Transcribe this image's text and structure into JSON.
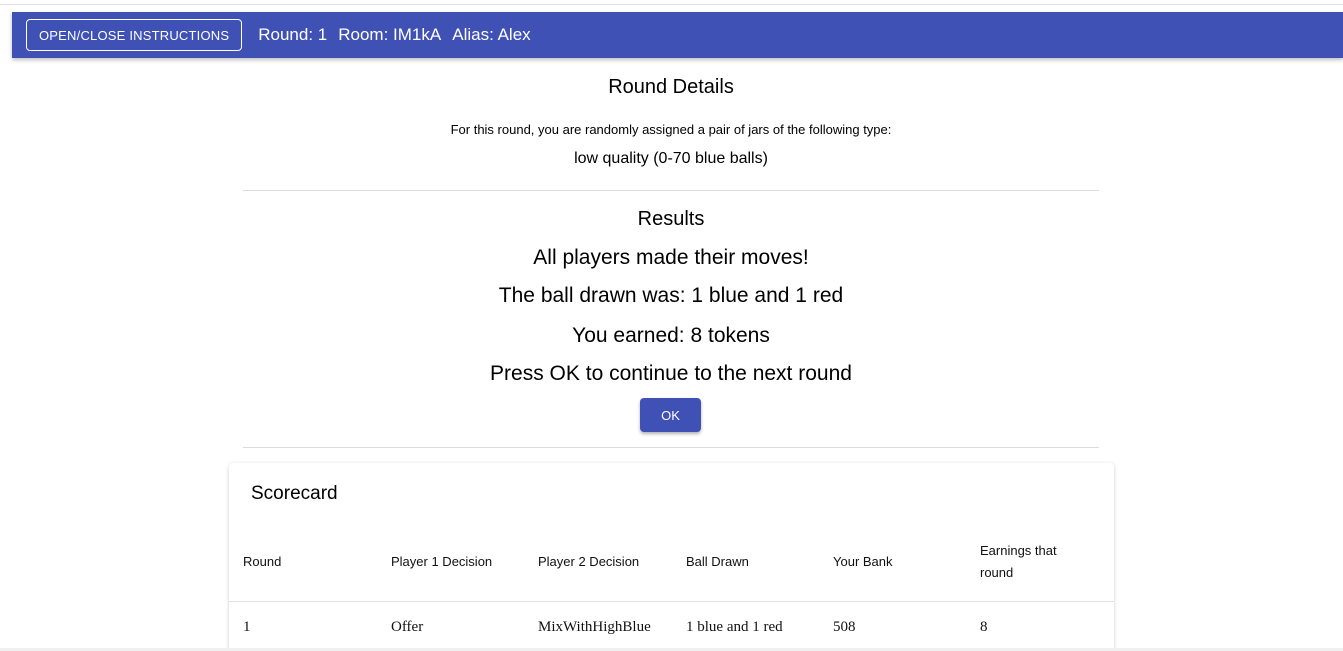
{
  "appbar": {
    "instructions_button": "OPEN/CLOSE INSTRUCTIONS",
    "round": "Round: 1",
    "room": "Room: IM1kA",
    "alias": "Alias: Alex",
    "color": "#3f51b5"
  },
  "round_details": {
    "title": "Round Details",
    "assignment_text": "For this round, you are randomly assigned a pair of jars of the following type:",
    "jar_type": "low quality (0-70 blue balls)"
  },
  "results": {
    "title": "Results",
    "status": "All players made their moves!",
    "ball_drawn": "The ball drawn was: 1 blue and 1 red",
    "earned": "You earned: 8 tokens",
    "prompt": "Press OK to continue to the next round",
    "ok_label": "OK"
  },
  "scorecard": {
    "title": "Scorecard",
    "headers": [
      "Round",
      "Player 1 Decision",
      "Player 2 Decision",
      "Ball Drawn",
      "Your Bank",
      "Earnings that round"
    ],
    "rows": [
      [
        "1",
        "Offer",
        "MixWithHighBlue",
        "1 blue and 1 red",
        "508",
        "8"
      ]
    ]
  }
}
